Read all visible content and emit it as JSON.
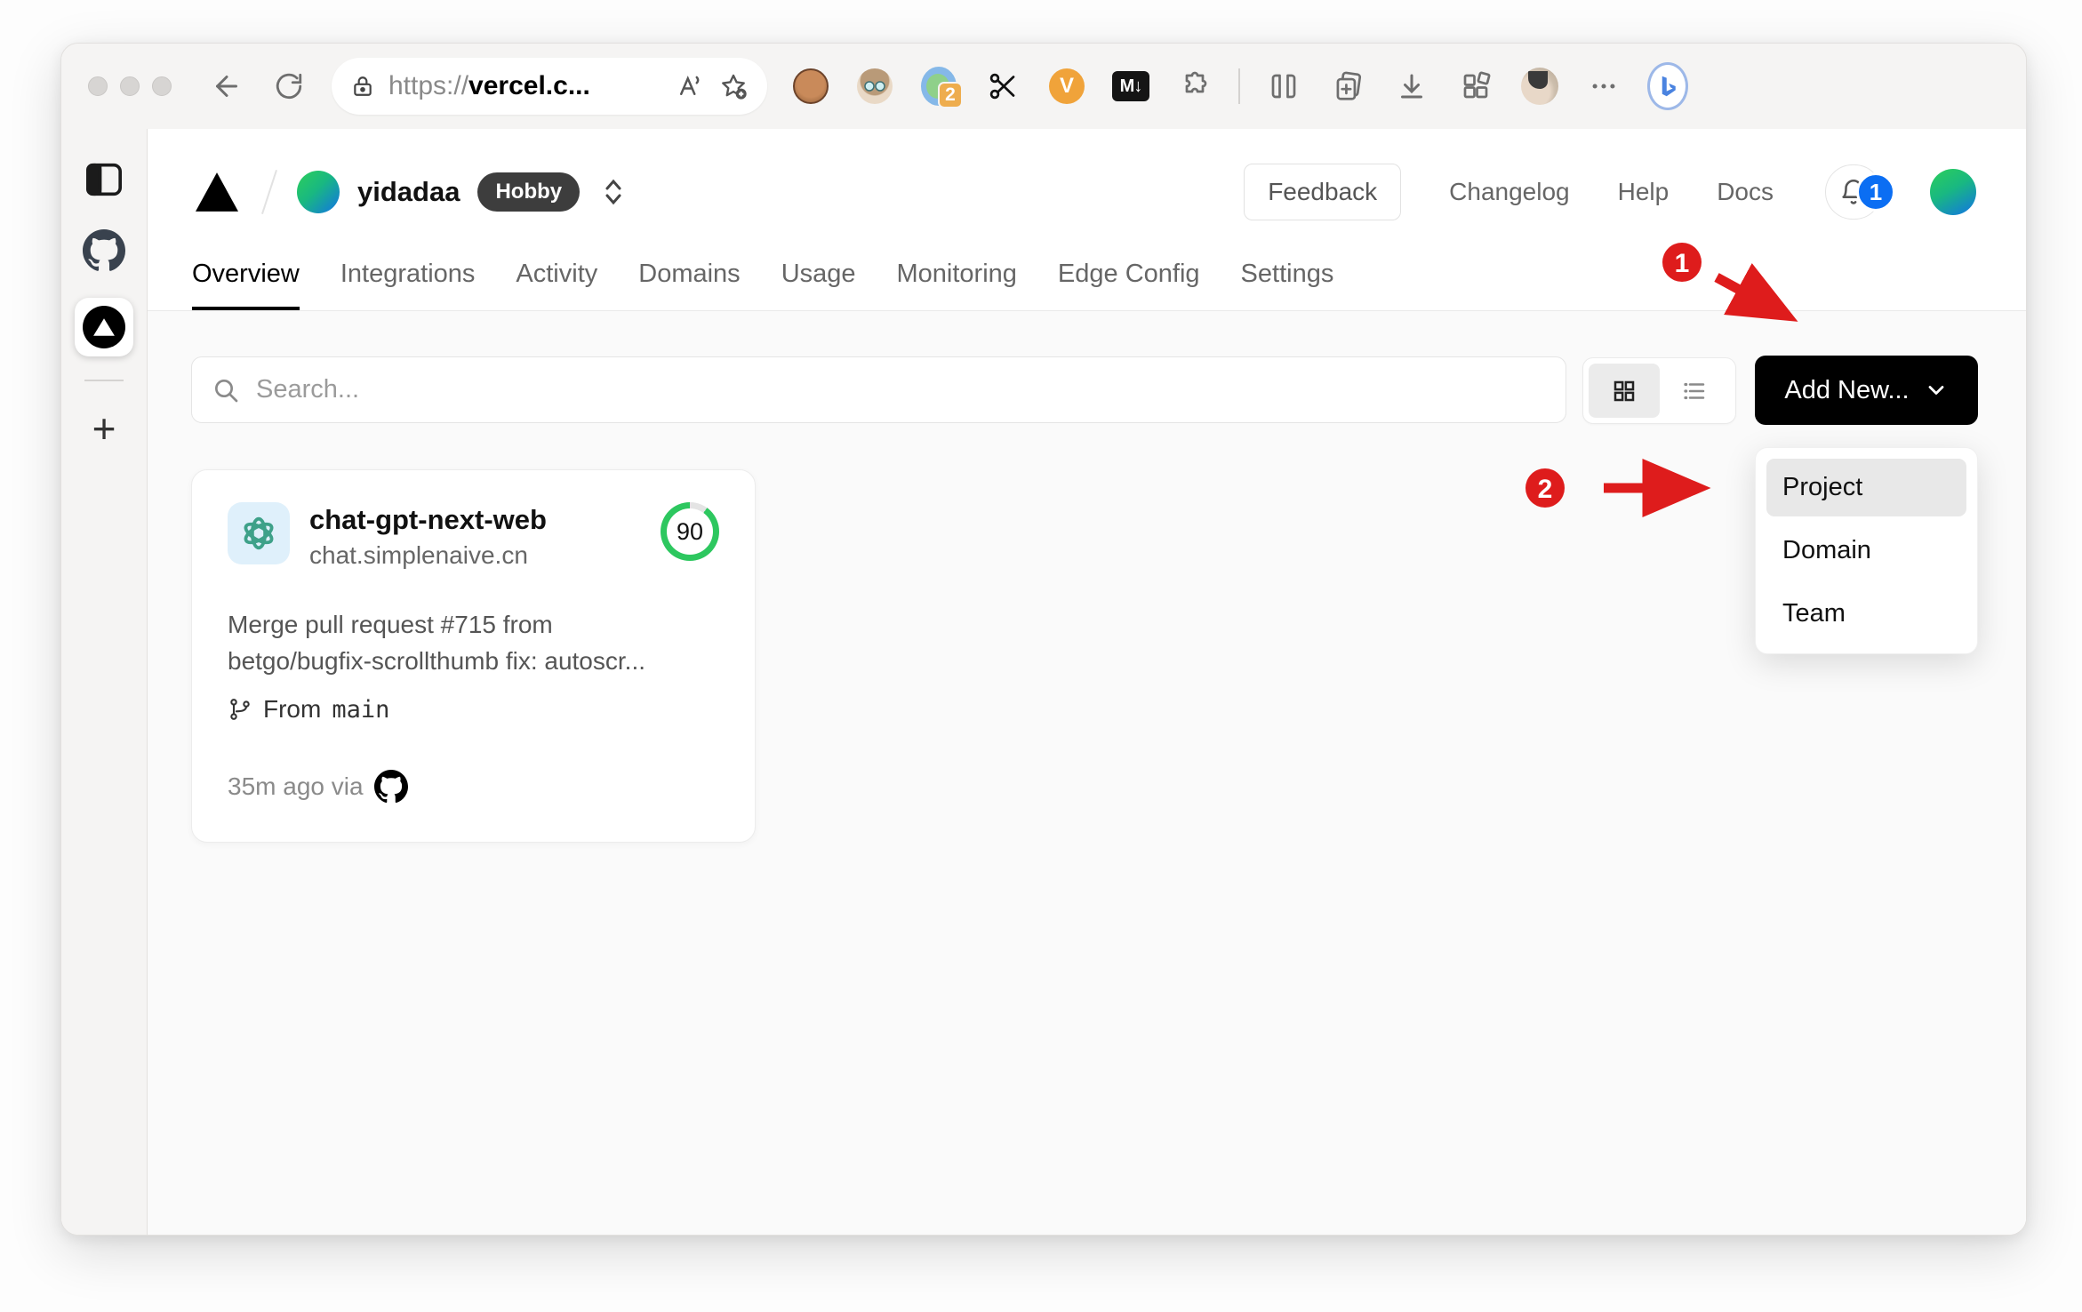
{
  "browser": {
    "url": {
      "scheme": "https://",
      "domain": "vercel.c..."
    },
    "extension_badge_count": "2",
    "markdown_ext_label": "M↓",
    "vc_ext_label": "V",
    "notification_extensions": [
      "tampermonkey",
      "persona",
      "translator",
      "scissors",
      "vc-tool",
      "markdown-downloader",
      "puzzle-extensions",
      "split-screen",
      "collections-add",
      "downloads",
      "apps",
      "profile",
      "more",
      "bing-chat"
    ]
  },
  "edge_sidebar": {
    "items": [
      "panel-toggle",
      "github",
      "vercel",
      "new-tab"
    ]
  },
  "header": {
    "team_name": "yidadaa",
    "plan_badge": "Hobby",
    "feedback_label": "Feedback",
    "links": [
      "Changelog",
      "Help",
      "Docs"
    ],
    "notification_count": "1"
  },
  "nav": {
    "active": "Overview",
    "items": [
      "Overview",
      "Integrations",
      "Activity",
      "Domains",
      "Usage",
      "Monitoring",
      "Edge Config",
      "Settings"
    ]
  },
  "toolbar": {
    "search_placeholder": "Search...",
    "add_new_label": "Add New..."
  },
  "dropdown": {
    "highlighted": "Project",
    "items": [
      "Project",
      "Domain",
      "Team"
    ]
  },
  "project_card": {
    "name": "chat-gpt-next-web",
    "domain": "chat.simplenaive.cn",
    "score": "90",
    "commit_lines": [
      "Merge pull request #715 from",
      "betgo/bugfix-scrollthumb fix: autoscr..."
    ],
    "branch_prefix": "From",
    "branch_name": "main",
    "meta": "35m ago via"
  },
  "annotations": {
    "step1": "1",
    "step2": "2"
  },
  "colors": {
    "annotation_red": "#de1c1c",
    "score_green": "#2dc75f",
    "notification_blue": "#0b6ef3",
    "button_black": "#000000",
    "openai_teal": "#3ea189",
    "content_bg": "#fafafa"
  }
}
